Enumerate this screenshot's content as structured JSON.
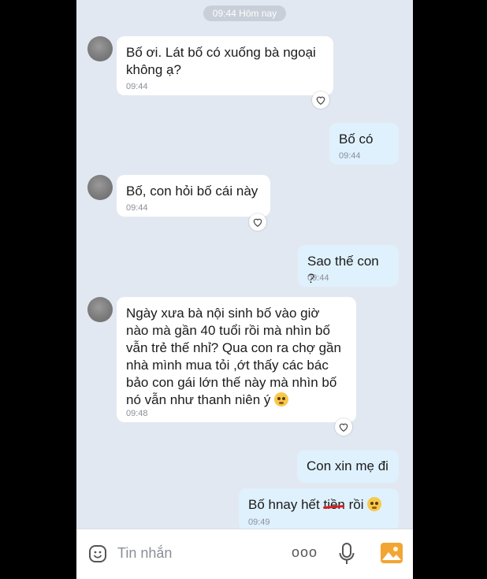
{
  "header": {
    "timestamp_pill": "09:44 Hôm nay"
  },
  "messages": [
    {
      "direction": "in",
      "text": "Bố ơi. Lát bố có xuống bà ngoại không ạ?",
      "time": "09:44"
    },
    {
      "direction": "out",
      "text": "Bố có",
      "time": "09:44"
    },
    {
      "direction": "in",
      "text": "Bố, con hỏi bố cái này",
      "time": "09:44"
    },
    {
      "direction": "out",
      "text": "Sao thế con ?",
      "time": "09:44"
    },
    {
      "direction": "in",
      "text": "Ngày xưa bà nội sinh bố vào giờ nào mà gần 40 tuổi rồi mà nhìn bố vẫn trẻ thế nhỉ? Qua con ra chợ gần nhà mình mua tỏi ,ớt thấy các bác bảo con gái lớn thế này mà nhìn bố nó vẫn như thanh niên ý",
      "time": "09:48"
    },
    {
      "direction": "out",
      "text": "Con xin mẹ đi",
      "time": ""
    },
    {
      "direction": "out",
      "text_before": "Bố hnay hết ",
      "text_struck": "tiền",
      "text_after": " rồi",
      "time": "09:49"
    }
  ],
  "input": {
    "placeholder": "Tin nhắn",
    "more_label": "ooo"
  },
  "icons": {
    "reaction": "heart-icon",
    "emoji": "smile-icon",
    "mic": "microphone-icon",
    "gallery": "image-icon"
  },
  "colors": {
    "background": "#e2e8f1",
    "outgoing_bubble": "#dff1fd",
    "incoming_bubble": "#ffffff",
    "accent": "#f3a531"
  }
}
